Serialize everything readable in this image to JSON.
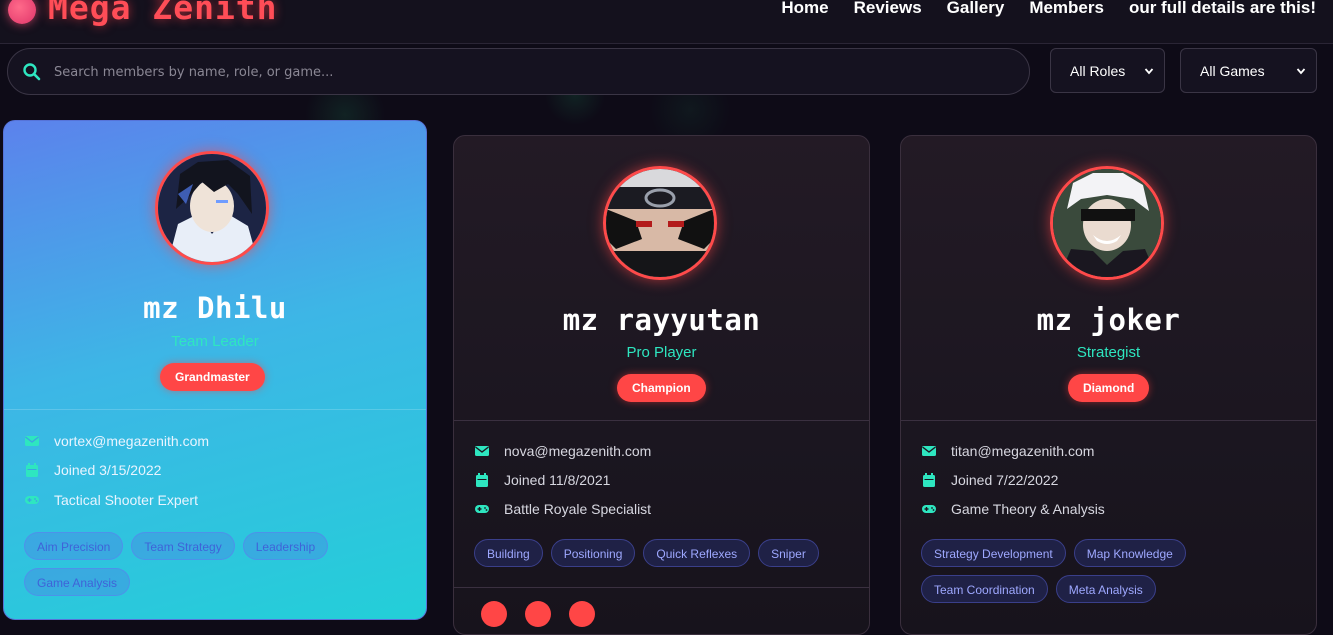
{
  "header": {
    "logo_text": "Mega Zenith",
    "nav": [
      "Home",
      "Reviews",
      "Gallery",
      "Members",
      "our full details are this!"
    ]
  },
  "search": {
    "placeholder": "Search members by name, role, or game...",
    "value": ""
  },
  "filters": {
    "roles": {
      "selected": "All Roles"
    },
    "games": {
      "selected": "All Games"
    }
  },
  "colors": {
    "accent_red": "#ff4646",
    "accent_teal": "#2ee6c0",
    "tag_text": "#9ea8ff"
  },
  "members": [
    {
      "name": "mz Dhilu",
      "role": "Team Leader",
      "rank": "Grandmaster",
      "email": "vortex@megazenith.com",
      "joined": "Joined 3/15/2022",
      "specialty": "Tactical Shooter Expert",
      "skills": [
        "Aim Precision",
        "Team Strategy",
        "Leadership",
        "Game Analysis"
      ]
    },
    {
      "name": "mz rayyutan",
      "role": "Pro Player",
      "rank": "Champion",
      "email": "nova@megazenith.com",
      "joined": "Joined 11/8/2021",
      "specialty": "Battle Royale Specialist",
      "skills": [
        "Building",
        "Positioning",
        "Quick Reflexes",
        "Sniper"
      ]
    },
    {
      "name": "mz joker",
      "role": "Strategist",
      "rank": "Diamond",
      "email": "titan@megazenith.com",
      "joined": "Joined 7/22/2022",
      "specialty": "Game Theory & Analysis",
      "skills": [
        "Strategy Development",
        "Map Knowledge",
        "Team Coordination",
        "Meta Analysis"
      ]
    }
  ]
}
